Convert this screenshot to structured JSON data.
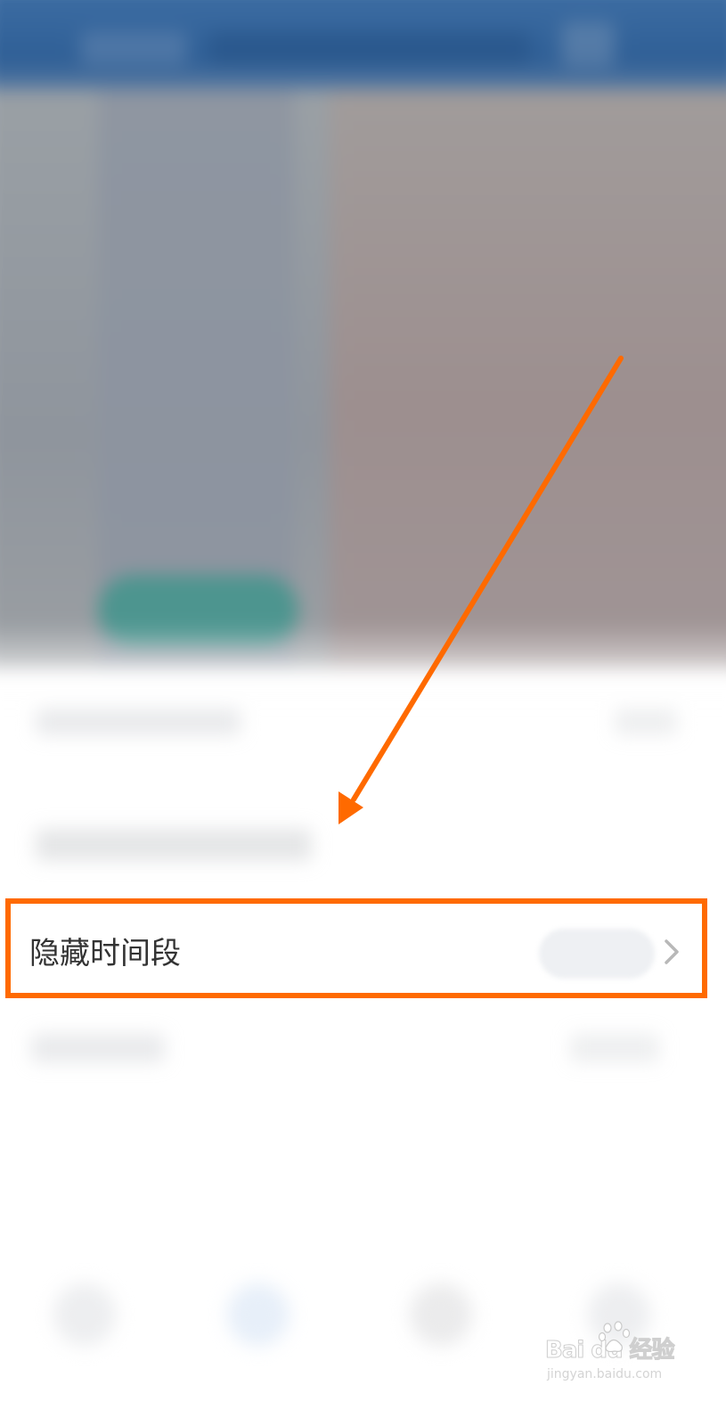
{
  "settings_row": {
    "label": "隐藏时间段"
  },
  "annotation": {
    "color": "#ff6a00"
  },
  "watermark": {
    "brand": "Bai  du 经验",
    "url": "jingyan.baidu.com"
  },
  "icons": {
    "chevron": "chevron-right-icon",
    "watermark_paw": "baidu-paw-icon"
  }
}
